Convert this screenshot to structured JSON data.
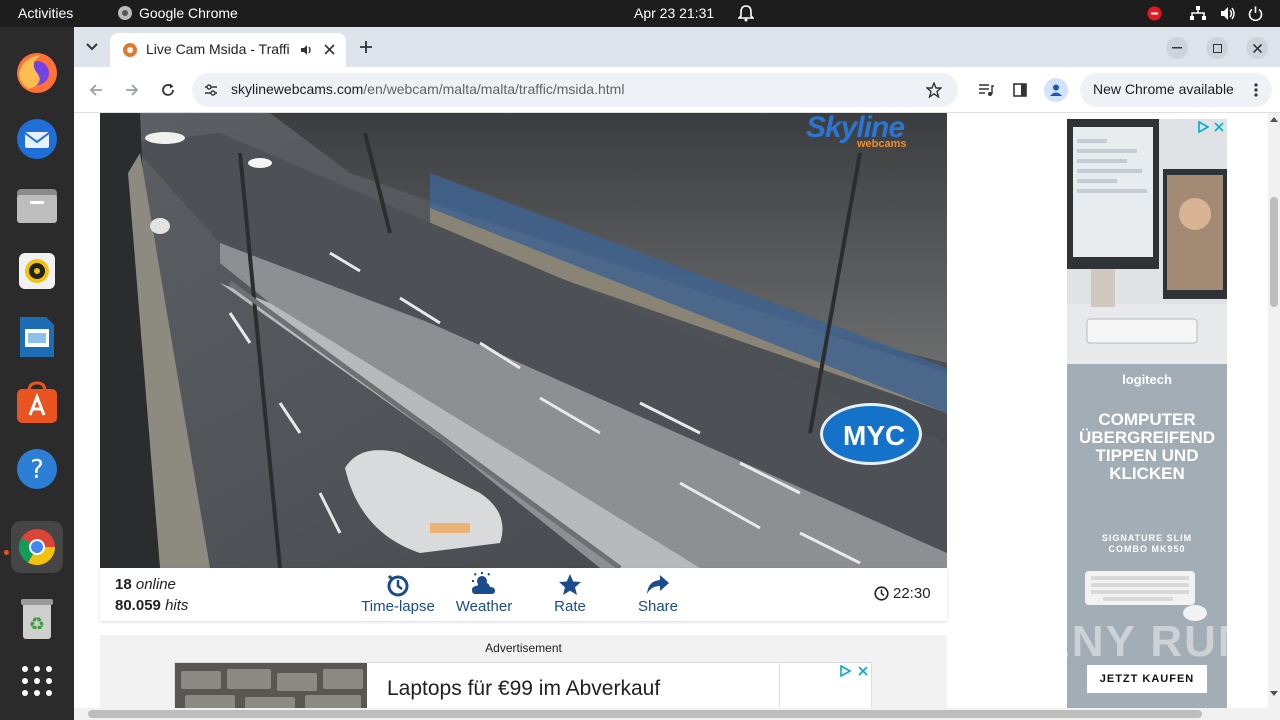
{
  "topbar": {
    "activities": "Activities",
    "app": "Google Chrome",
    "datetime": "Apr 23  21:31"
  },
  "tab": {
    "title": "Live Cam Msida - Traffi"
  },
  "url": {
    "domain": "skylinewebcams.com",
    "path": "/en/webcam/malta/malta/traffic/msida.html"
  },
  "update_chip": "New Chrome available",
  "cam": {
    "logo_main": "Skyline",
    "logo_sub": "webcams",
    "myc": "MYC",
    "online_count": "18",
    "online_label": "online",
    "hits_count": "80.059",
    "hits_label": "hits",
    "actions": [
      {
        "label": "Time-lapse",
        "icon": "timelapse-icon"
      },
      {
        "label": "Weather",
        "icon": "weather-icon"
      },
      {
        "label": "Rate",
        "icon": "star-icon"
      },
      {
        "label": "Share",
        "icon": "share-icon"
      }
    ],
    "time": "22:30"
  },
  "advert": {
    "label": "Advertisement",
    "banner_text": "Laptops für €99 im Abverkauf"
  },
  "side_ad": {
    "brand": "logitech",
    "headline": "COMPUTER ÜBERGREIFEND TIPPEN UND KLICKEN",
    "product": "SIGNATURE SLIM COMBO MK950",
    "cta": "JETZT KAUFEN"
  },
  "watermark": "ANY RUN",
  "colors": {
    "accent": "#1a4c8c",
    "topbar": "#1d1d1d",
    "dock": "#2b2b2b"
  }
}
